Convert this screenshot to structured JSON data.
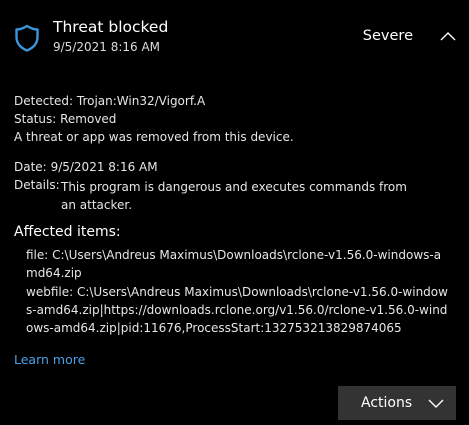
{
  "header": {
    "title": "Threat blocked",
    "timestamp": "9/5/2021 8:16 AM",
    "severity": "Severe",
    "icon": "shield-icon",
    "collapse_icon": "chevron-up-icon"
  },
  "summary": {
    "detected_label": "Detected:",
    "detected_value": "Trojan:Win32/Vigorf.A",
    "status_label": "Status:",
    "status_value": "Removed",
    "message": "A threat or app was removed from this device."
  },
  "info": {
    "date_label": "Date:",
    "date_value": "9/5/2021 8:16 AM",
    "details_label": "Details:",
    "details_value": "This program is dangerous and executes commands from an attacker."
  },
  "affected": {
    "heading": "Affected items:",
    "items": [
      "file: C:\\Users\\Andreus Maximus\\Downloads\\rclone-v1.56.0-windows-amd64.zip",
      "webfile: C:\\Users\\Andreus Maximus\\Downloads\\rclone-v1.56.0-windows-amd64.zip|https://downloads.rclone.org/v1.56.0/rclone-v1.56.0-windows-amd64.zip|pid:11676,ProcessStart:132753213829874065"
    ]
  },
  "links": {
    "learn_more": "Learn more"
  },
  "actions": {
    "label": "Actions",
    "icon": "chevron-down-icon"
  },
  "colors": {
    "background": "#000000",
    "accent_link": "#4aa0e6",
    "shield": "#3a96dd",
    "button_bg": "#333333"
  }
}
